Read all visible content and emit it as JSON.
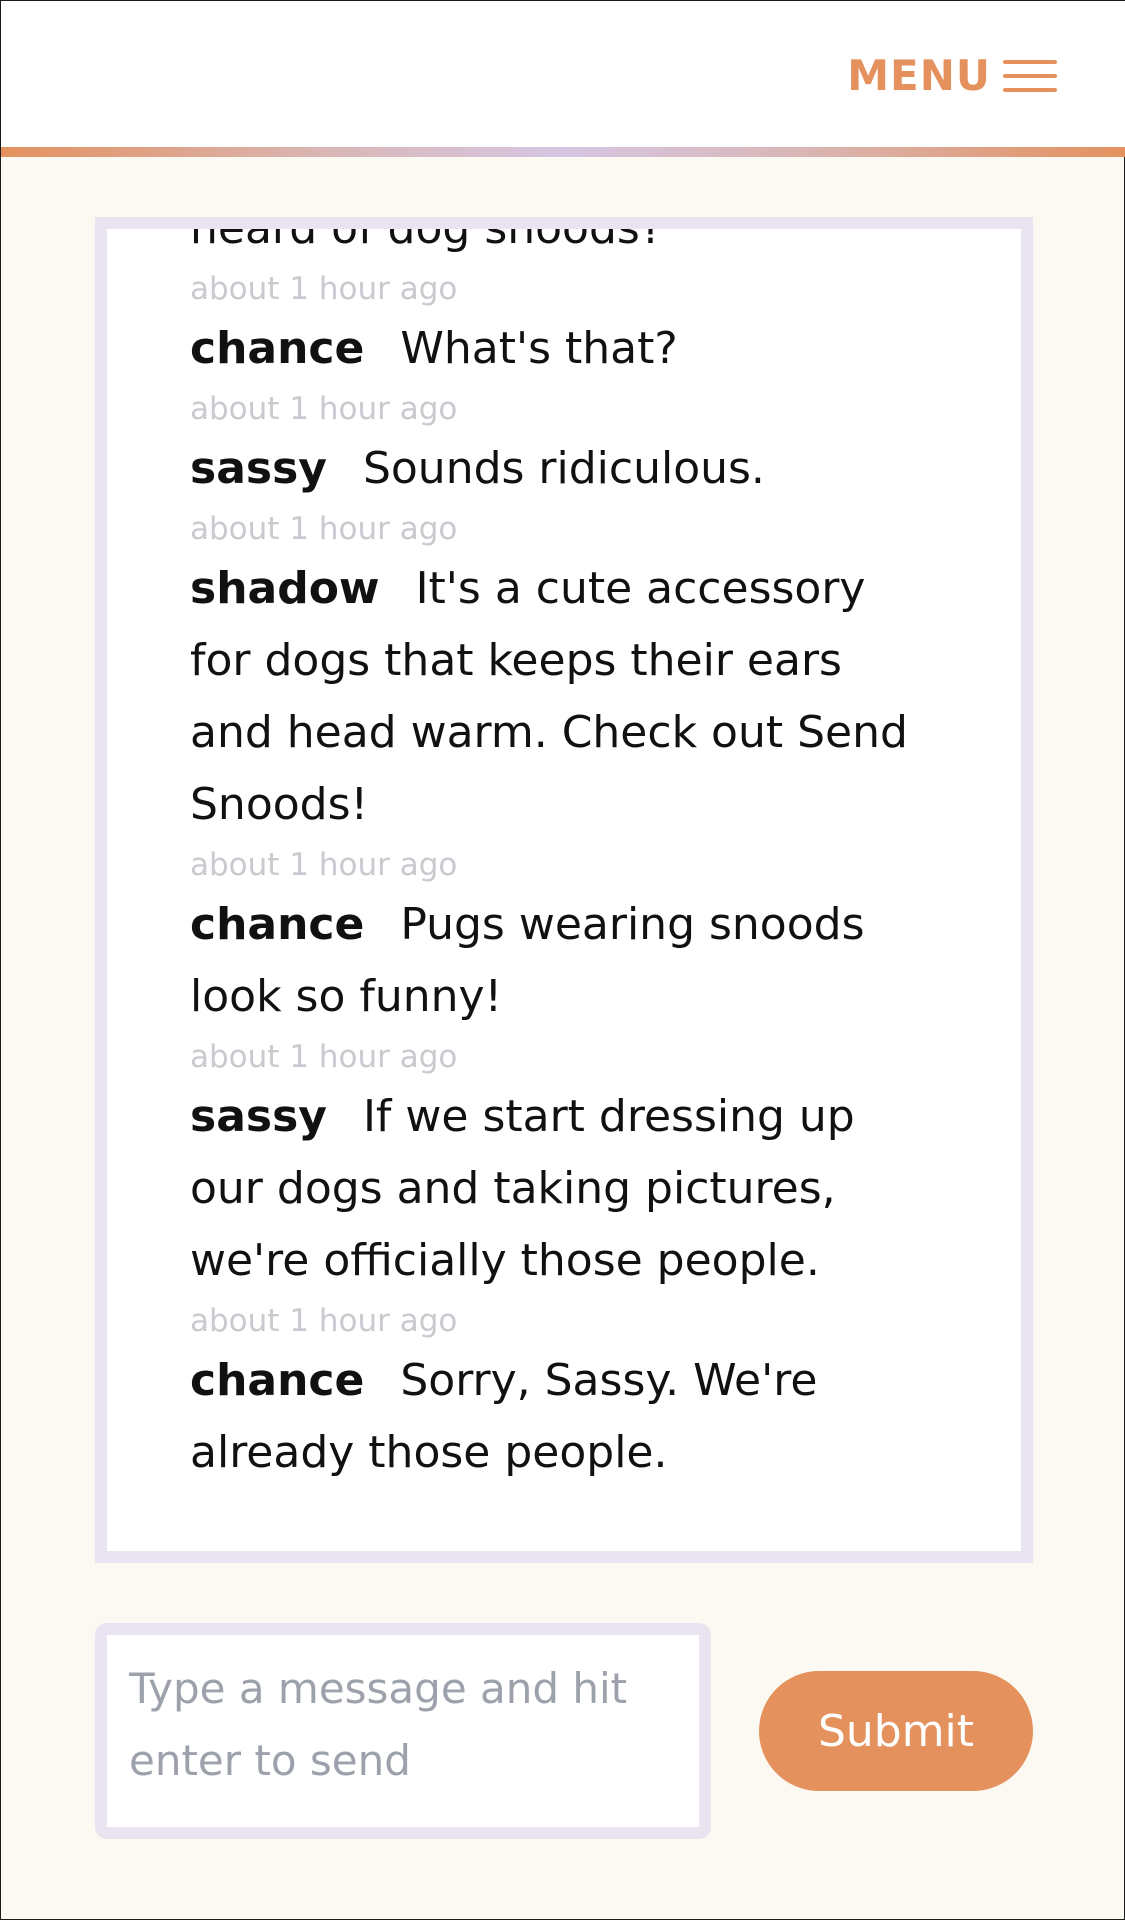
{
  "header": {
    "menu_label": "MENU",
    "menu_icon": "hamburger-menu-icon",
    "accent_color": "#e4915e"
  },
  "chat": {
    "messages": [
      {
        "user": "",
        "text": "heard of dog snoods?",
        "time": "about 1 hour ago"
      },
      {
        "user": "chance",
        "text": "What's that?",
        "time": "about 1 hour ago"
      },
      {
        "user": "sassy",
        "text": "Sounds ridiculous.",
        "time": "about 1 hour ago"
      },
      {
        "user": "shadow",
        "text": "It's a cute accessory for dogs that keeps their ears and head warm. Check out Send Snoods!",
        "time": "about 1 hour ago"
      },
      {
        "user": "chance",
        "text": "Pugs wearing snoods look so funny!",
        "time": "about 1 hour ago"
      },
      {
        "user": "sassy",
        "text": "If we start dressing up our dogs and taking pictures, we're officially those people.",
        "time": "about 1 hour ago"
      },
      {
        "user": "chance",
        "text": "Sorry, Sassy. We're already those people.",
        "time": ""
      }
    ]
  },
  "composer": {
    "placeholder": "Type a message and hit enter to send",
    "value": "",
    "submit_label": "Submit"
  }
}
